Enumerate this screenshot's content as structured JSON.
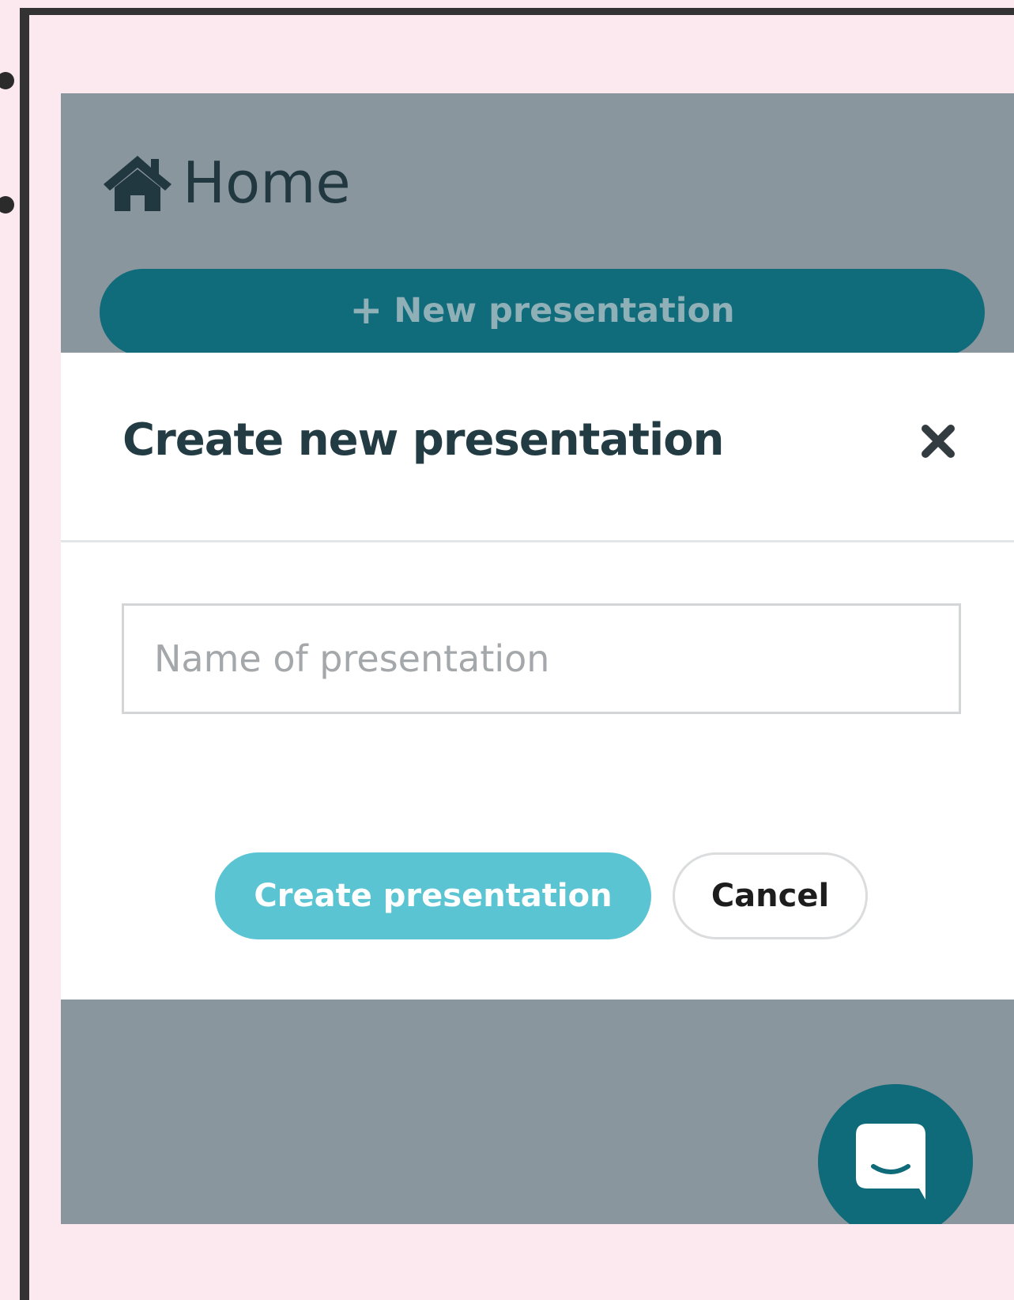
{
  "header": {
    "title": "Home",
    "icon": "home-icon"
  },
  "toolbar": {
    "new_presentation_plus": "+",
    "new_presentation_label": "New presentation"
  },
  "modal": {
    "title": "Create new presentation",
    "close_icon": "close-icon",
    "name_input": {
      "placeholder": "Name of presentation",
      "value": ""
    },
    "create_label": "Create presentation",
    "cancel_label": "Cancel"
  },
  "chat": {
    "icon": "chat-icon"
  },
  "colors": {
    "page_background": "#fce8ef",
    "overlay": "#8a969d",
    "brand_dark": "#106b7b",
    "brand_light": "#5bc4d3",
    "title_text": "#233c44"
  }
}
